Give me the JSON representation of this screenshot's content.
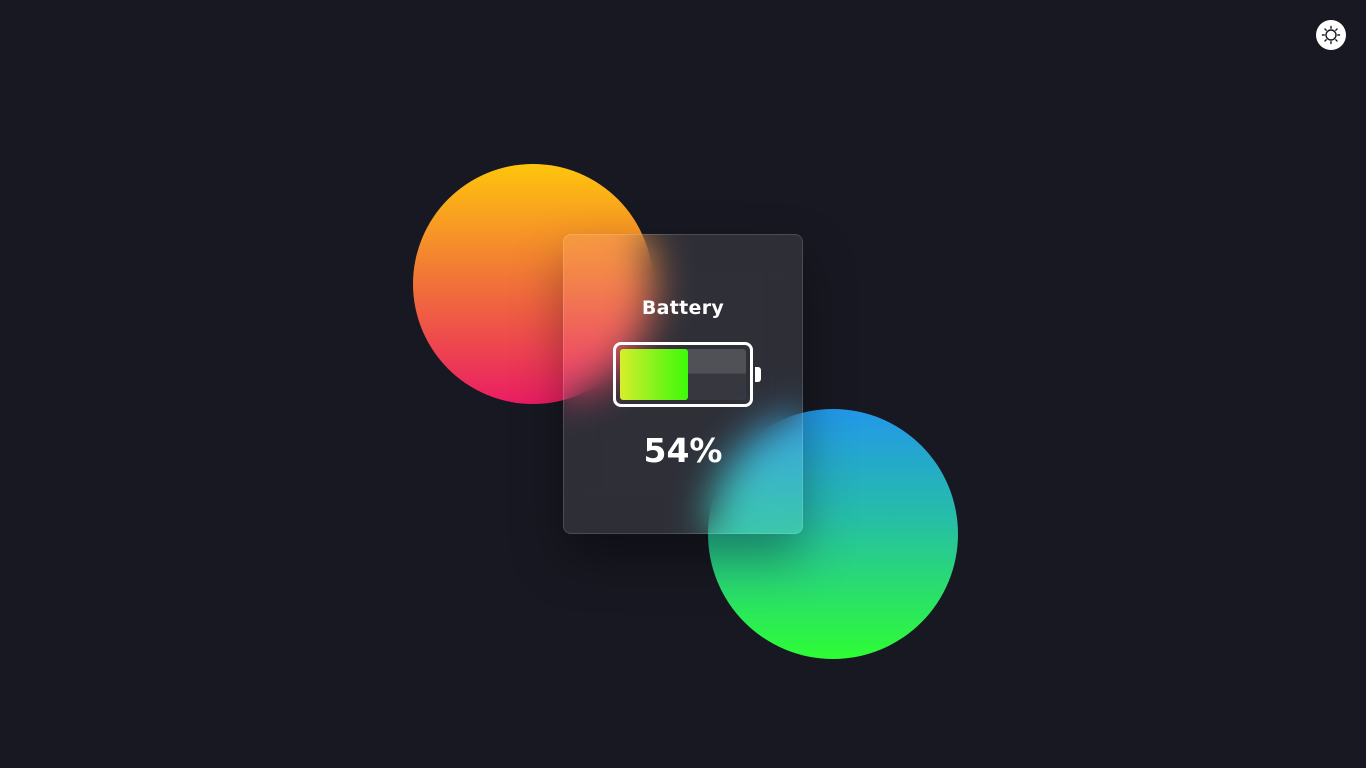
{
  "theme_toggle": {
    "icon": "sun-icon",
    "background": "#ffffff"
  },
  "background": {
    "color": "#171821",
    "orbs": [
      {
        "name": "warm-orb",
        "colors": [
          "#ffc50c",
          "#f27a35",
          "#ea1d63"
        ]
      },
      {
        "name": "cool-orb",
        "colors": [
          "#2397ea",
          "#26bfa5",
          "#2efd34"
        ]
      }
    ]
  },
  "battery_card": {
    "title": "Battery",
    "level": 0.54,
    "percent_label": "54%",
    "fill_colors": [
      "#d6ef2c",
      "#3dfb09"
    ]
  }
}
